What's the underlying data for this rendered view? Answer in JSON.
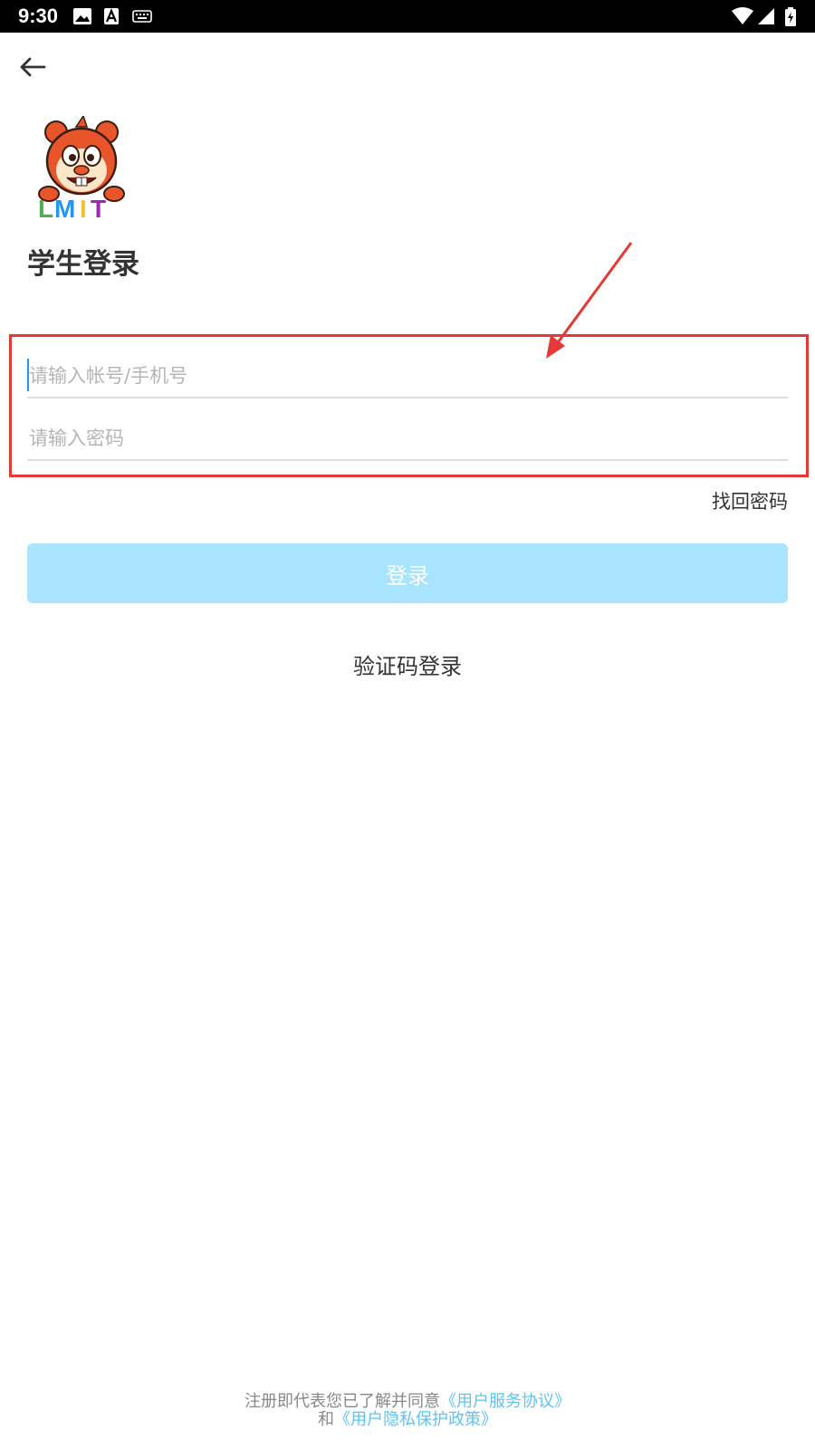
{
  "status_bar": {
    "time": "9:30",
    "left_icons": [
      "image-icon",
      "text-a-icon",
      "keyboard-icon"
    ],
    "right_icons": [
      "wifi-icon",
      "cellular-signal-icon",
      "battery-charging-icon"
    ]
  },
  "nav": {
    "back_icon": "arrow-left-icon"
  },
  "logo": {
    "text": "LMIT",
    "mascot": "squirrel"
  },
  "title": "学生登录",
  "form": {
    "account": {
      "value": "",
      "placeholder": "请输入帐号/手机号"
    },
    "password": {
      "value": "",
      "placeholder": "请输入密码"
    },
    "find_password": "找回密码",
    "login_button": "登录",
    "code_login": "验证码登录"
  },
  "footer": {
    "line1_prefix": "注册即代表您已了解并同意",
    "service_link": "《用户服务协议》",
    "line2_prefix": "和",
    "privacy_link": "《用户隐私保护政策》"
  },
  "colors": {
    "accent_light_blue": "#a8e4fe",
    "link_blue": "#5ec3f5",
    "annotation_red": "#e53935",
    "status_bar": "#000000"
  }
}
